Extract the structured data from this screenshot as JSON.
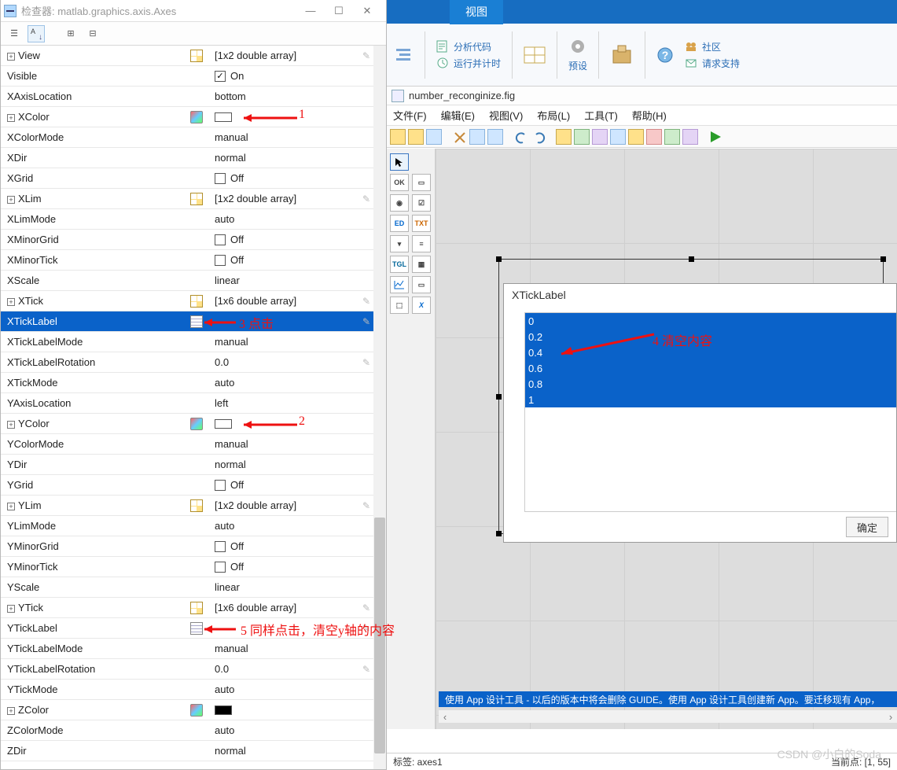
{
  "inspector": {
    "title": "检查器: matlab.graphics.axis.Axes",
    "rows": [
      {
        "name": "View",
        "mid": "grid",
        "val": "[1x2  double array]",
        "pencil": true,
        "expand": true
      },
      {
        "name": "Visible",
        "mid": "",
        "val": "On",
        "check": true
      },
      {
        "name": "XAxisLocation",
        "mid": "",
        "val": "bottom"
      },
      {
        "name": "XColor",
        "mid": "color",
        "val": "",
        "swatch": "white",
        "expand": true
      },
      {
        "name": "XColorMode",
        "mid": "",
        "val": "manual"
      },
      {
        "name": "XDir",
        "mid": "",
        "val": "normal"
      },
      {
        "name": "XGrid",
        "mid": "",
        "val": "Off",
        "check": false
      },
      {
        "name": "XLim",
        "mid": "grid",
        "val": "[1x2  double array]",
        "pencil": true,
        "expand": true
      },
      {
        "name": "XLimMode",
        "mid": "",
        "val": "auto"
      },
      {
        "name": "XMinorGrid",
        "mid": "",
        "val": "Off",
        "check": false
      },
      {
        "name": "XMinorTick",
        "mid": "",
        "val": "Off",
        "check": false
      },
      {
        "name": "XScale",
        "mid": "",
        "val": "linear"
      },
      {
        "name": "XTick",
        "mid": "grid",
        "val": "[1x6  double array]",
        "pencil": true,
        "expand": true
      },
      {
        "name": "XTickLabel",
        "mid": "edit",
        "val": "",
        "pencil": true,
        "selected": true
      },
      {
        "name": "XTickLabelMode",
        "mid": "",
        "val": "manual"
      },
      {
        "name": "XTickLabelRotation",
        "mid": "",
        "val": "0.0",
        "pencil": true
      },
      {
        "name": "XTickMode",
        "mid": "",
        "val": "auto"
      },
      {
        "name": "YAxisLocation",
        "mid": "",
        "val": "left"
      },
      {
        "name": "YColor",
        "mid": "color",
        "val": "",
        "swatch": "white",
        "expand": true
      },
      {
        "name": "YColorMode",
        "mid": "",
        "val": "manual"
      },
      {
        "name": "YDir",
        "mid": "",
        "val": "normal"
      },
      {
        "name": "YGrid",
        "mid": "",
        "val": "Off",
        "check": false
      },
      {
        "name": "YLim",
        "mid": "grid",
        "val": "[1x2  double array]",
        "pencil": true,
        "expand": true
      },
      {
        "name": "YLimMode",
        "mid": "",
        "val": "auto"
      },
      {
        "name": "YMinorGrid",
        "mid": "",
        "val": "Off",
        "check": false
      },
      {
        "name": "YMinorTick",
        "mid": "",
        "val": "Off",
        "check": false
      },
      {
        "name": "YScale",
        "mid": "",
        "val": "linear"
      },
      {
        "name": "YTick",
        "mid": "grid",
        "val": "[1x6  double array]",
        "pencil": true,
        "expand": true
      },
      {
        "name": "YTickLabel",
        "mid": "edit",
        "val": "",
        "pencil": true
      },
      {
        "name": "YTickLabelMode",
        "mid": "",
        "val": "manual"
      },
      {
        "name": "YTickLabelRotation",
        "mid": "",
        "val": "0.0",
        "pencil": true
      },
      {
        "name": "YTickMode",
        "mid": "",
        "val": "auto"
      },
      {
        "name": "ZColor",
        "mid": "color",
        "val": "",
        "swatch": "black",
        "expand": true
      },
      {
        "name": "ZColorMode",
        "mid": "",
        "val": "auto"
      },
      {
        "name": "ZDir",
        "mid": "",
        "val": "normal"
      }
    ]
  },
  "ribbon": {
    "tab_view": "视图",
    "analyze": "分析代码",
    "run_time": "运行并计时",
    "preset": "预设",
    "community": "社区",
    "support": "请求支持"
  },
  "file_row": {
    "filename": "number_reconginize.fig"
  },
  "editor_menu": {
    "file": "文件(F)",
    "edit": "编辑(E)",
    "view": "视图(V)",
    "layout": "布局(L)",
    "tools": "工具(T)",
    "help": "帮助(H)"
  },
  "popup": {
    "title": "XTickLabel",
    "lines": [
      "0",
      "0.2",
      "0.4",
      "0.6",
      "0.8",
      "1"
    ],
    "ok": "确定"
  },
  "notice": "使用 App 设计工具 - 以后的版本中将会删除 GUIDE。使用 App 设计工具创建新 App。要迁移现有 App，",
  "status": {
    "left": "标签:  axes1",
    "right": "当前点:   [1, 55]"
  },
  "annotations": {
    "a1": "1",
    "a2": "2",
    "a3": "3 点击",
    "a4": "4 清空内容",
    "a5": "5 同样点击，清空y轴的内容"
  },
  "watermark": "CSDN @小白的Soda"
}
